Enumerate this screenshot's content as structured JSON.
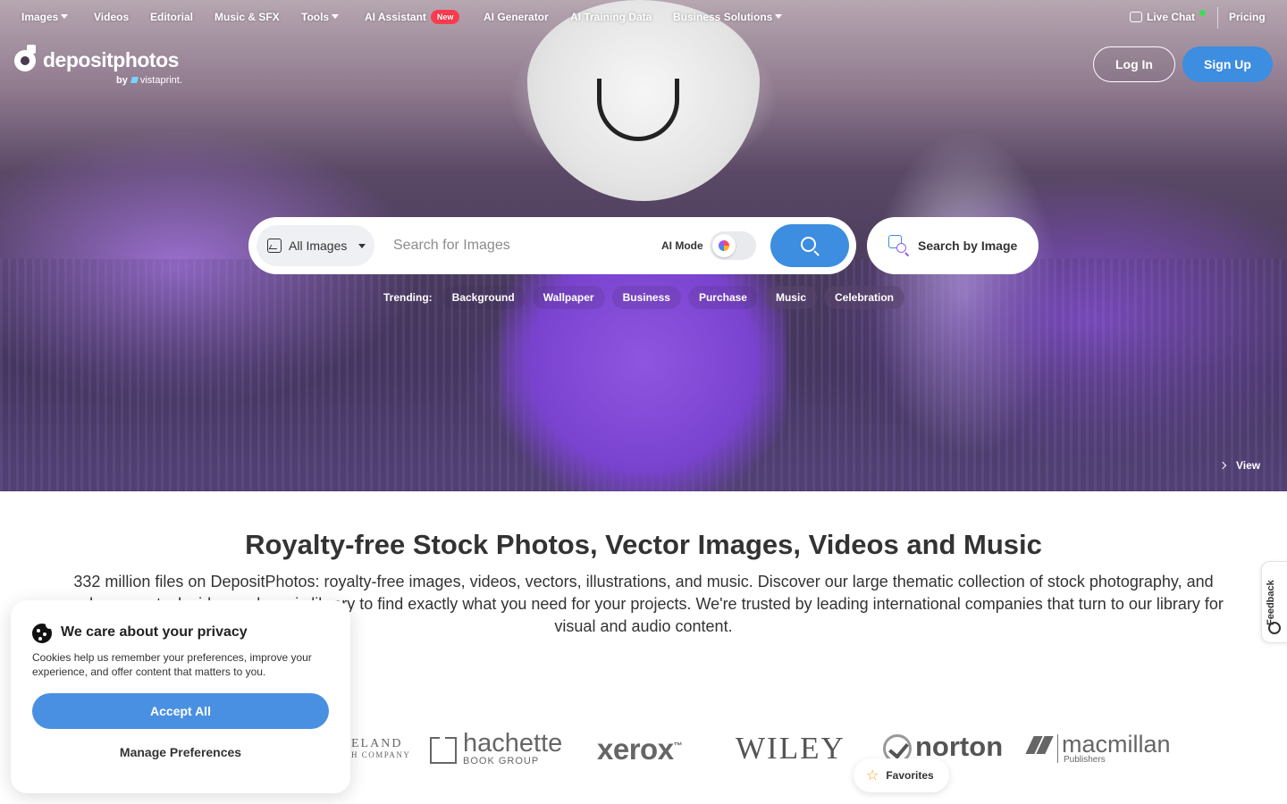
{
  "nav": {
    "items": [
      {
        "label": "Images",
        "dropdown": true
      },
      {
        "label": "Videos"
      },
      {
        "label": "Editorial"
      },
      {
        "label": "Music & SFX"
      },
      {
        "label": "Tools",
        "dropdown": true
      },
      {
        "label": "AI Assistant",
        "badge": "New"
      },
      {
        "label": "AI Generator"
      },
      {
        "label": "AI Training Data"
      },
      {
        "label": "Business Solutions",
        "dropdown": true
      }
    ],
    "live_chat": "Live Chat",
    "pricing": "Pricing"
  },
  "logo": {
    "name": "depositphotos",
    "by": "by",
    "partner": "vistaprint."
  },
  "auth": {
    "login": "Log In",
    "signup": "Sign Up"
  },
  "search": {
    "type_selected": "All Images",
    "placeholder": "Search for Images",
    "ai_mode_label": "AI Mode",
    "search_by_image": "Search by Image"
  },
  "trending": {
    "label": "Trending:",
    "tags": [
      "Background",
      "Wallpaper",
      "Business",
      "Purchase",
      "Music",
      "Celebration"
    ]
  },
  "hero": {
    "view_label": "View"
  },
  "content": {
    "title": "Royalty-free Stock Photos, Vector Images, Videos and Music",
    "description": "332 million files on DepositPhotos: royalty-free images, videos, vectors, illustrations, and music. Discover our large thematic collection of stock photography, and explore our stock video and music library to find exactly what you need for your projects. We're trusted by leading international companies that turn to our library for visual and audio content."
  },
  "brands": {
    "cleveland": "ELAND",
    "cleveland_sub": "H COMPANY",
    "hachette": "hachette",
    "hachette_sub": "BOOK GROUP",
    "xerox": "xerox",
    "xerox_tm": "™",
    "wiley": "WILEY",
    "norton": "norton",
    "macmillan": "macmillan",
    "macmillan_sub": "Publishers"
  },
  "feedback": "Feedback",
  "favorites": "Favorites",
  "cookie": {
    "title": "We care about your privacy",
    "text": "Cookies help us remember your preferences, improve your experience, and offer content that matters to you.",
    "accept": "Accept All",
    "manage": "Manage Preferences"
  },
  "colors": {
    "accent": "#3d8de0",
    "badge": "#ff3b4e",
    "hero_purple": "#7a43cf"
  }
}
